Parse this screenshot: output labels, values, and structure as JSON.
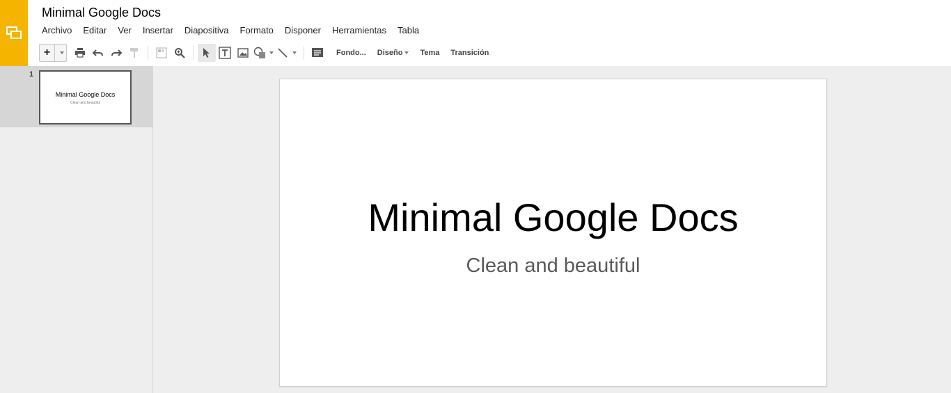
{
  "app": {
    "title": "Minimal Google Docs",
    "logo_icon": "slides-logo-icon",
    "accent_color": "#f4b400"
  },
  "menu": [
    {
      "label": "Archivo"
    },
    {
      "label": "Editar"
    },
    {
      "label": "Ver"
    },
    {
      "label": "Insertar"
    },
    {
      "label": "Diapositiva"
    },
    {
      "label": "Formato"
    },
    {
      "label": "Disponer"
    },
    {
      "label": "Herramientas"
    },
    {
      "label": "Tabla"
    }
  ],
  "toolbar": {
    "new_slide_label": "+",
    "icons": [
      "print-icon",
      "undo-icon",
      "redo-icon",
      "paint-format-icon",
      "zoom-fit-icon",
      "zoom-icon",
      "select-icon",
      "text-box-icon",
      "image-icon",
      "shape-icon",
      "line-icon",
      "comment-icon"
    ],
    "background_label": "Fondo...",
    "layout_label": "Diseño",
    "theme_label": "Tema",
    "transition_label": "Transición"
  },
  "filmstrip": {
    "slides": [
      {
        "number": "1",
        "title": "Minimal Google Docs",
        "subtitle": "Clean and beautiful"
      }
    ]
  },
  "slide": {
    "title": "Minimal Google Docs",
    "subtitle": "Clean and beautiful"
  }
}
